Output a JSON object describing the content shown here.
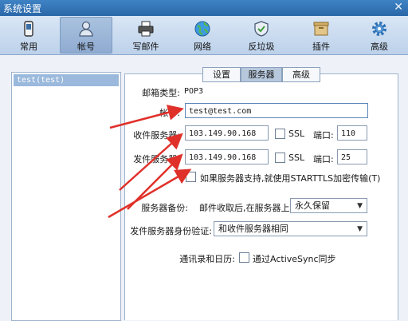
{
  "window": {
    "title": "系统设置",
    "close": "✕"
  },
  "toolbar": [
    {
      "label": "常用",
      "icon": "phone-icon"
    },
    {
      "label": "帐号",
      "icon": "user-icon",
      "active": true
    },
    {
      "label": "写邮件",
      "icon": "printer-icon"
    },
    {
      "label": "网络",
      "icon": "globe-icon"
    },
    {
      "label": "反垃圾",
      "icon": "shield-icon"
    },
    {
      "label": "插件",
      "icon": "box-icon"
    },
    {
      "label": "高级",
      "icon": "gear-icon"
    }
  ],
  "accounts": [
    "test(test)"
  ],
  "tabs": [
    {
      "label": "设置"
    },
    {
      "label": "服务器",
      "selected": true
    },
    {
      "label": "高级"
    }
  ],
  "form": {
    "mailbox_type_label": "邮箱类型:",
    "mailbox_type_value": "POP3",
    "account_label": "帐号:",
    "account_value": "test@test.com",
    "incoming_label": "收件服务器:",
    "incoming_value": "103.149.90.168",
    "incoming_ssl_label": "SSL",
    "incoming_port_label": "端口:",
    "incoming_port_value": "110",
    "outgoing_label": "发件服务器:",
    "outgoing_value": "103.149.90.168",
    "outgoing_ssl_label": "SSL",
    "outgoing_port_label": "端口:",
    "outgoing_port_value": "25",
    "starttls_label": "如果服务器支持,就使用STARTTLS加密传输(T)",
    "backup_label": "服务器备份:",
    "backup_prefix": "邮件收取后,在服务器上",
    "backup_value": "永久保留",
    "auth_label": "发件服务器身份验证:",
    "auth_value": "和收件服务器相同",
    "contacts_label": "通讯录和日历:",
    "activesync_label": "通过ActiveSync同步"
  },
  "colors": {
    "titlebar": "#2f72b6",
    "arrow": "#e0302a",
    "toolbar": "#c8daf0"
  }
}
